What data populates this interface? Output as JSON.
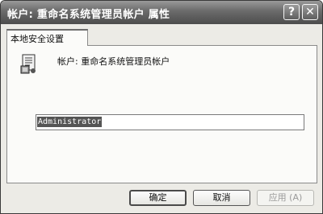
{
  "window": {
    "title": "帐户: 重命名系统管理员帐户 属性"
  },
  "titlebar_buttons": {
    "help": "?",
    "close": "✕"
  },
  "tab": {
    "label": "本地安全设置"
  },
  "policy": {
    "icon": "policy-document-icon",
    "label": "帐户: 重命名系统管理员帐户",
    "value": "Administrator"
  },
  "buttons": {
    "ok": "确定",
    "cancel": "取消",
    "apply": "应用 (A)"
  },
  "colors": {
    "titlebar": "#6e6e6e",
    "dialog_bg": "#ecebe6",
    "panel_bg": "#fbfbf9",
    "selection": "#555555"
  }
}
